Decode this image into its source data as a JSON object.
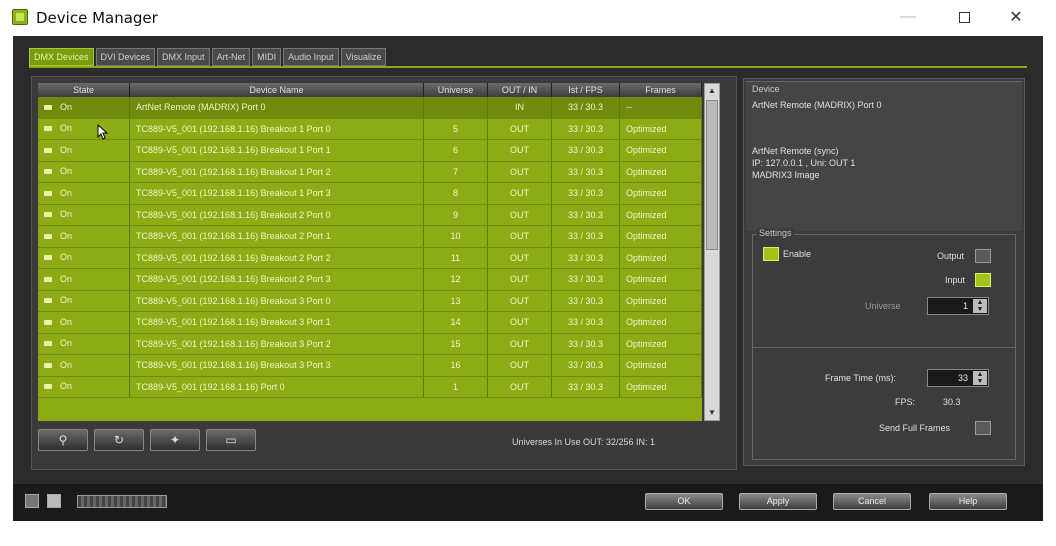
{
  "window": {
    "title": "Device Manager"
  },
  "tabs": [
    "DMX Devices",
    "DVI Devices",
    "DMX Input",
    "Art-Net",
    "MIDI",
    "Audio Input",
    "Visualize"
  ],
  "table": {
    "headers": [
      "State",
      "Device Name",
      "Universe",
      "OUT / IN",
      "Ist / FPS",
      "Frames"
    ],
    "rows": [
      {
        "state": "On",
        "name": "ArtNet Remote (MADRIX) Port 0",
        "universe": "",
        "outin": "IN",
        "fps": "33 / 30.3",
        "frames": "--"
      },
      {
        "state": "On",
        "name": "TC889-V5_001 (192.168.1.16) Breakout 1 Port 0",
        "universe": "5",
        "outin": "OUT",
        "fps": "33 / 30.3",
        "frames": "Optimized"
      },
      {
        "state": "On",
        "name": "TC889-V5_001 (192.168.1.16) Breakout 1 Port 1",
        "universe": "6",
        "outin": "OUT",
        "fps": "33 / 30.3",
        "frames": "Optimized"
      },
      {
        "state": "On",
        "name": "TC889-V5_001 (192.168.1.16) Breakout 1 Port 2",
        "universe": "7",
        "outin": "OUT",
        "fps": "33 / 30.3",
        "frames": "Optimized"
      },
      {
        "state": "On",
        "name": "TC889-V5_001 (192.168.1.16) Breakout 1 Port 3",
        "universe": "8",
        "outin": "OUT",
        "fps": "33 / 30.3",
        "frames": "Optimized"
      },
      {
        "state": "On",
        "name": "TC889-V5_001 (192.168.1.16) Breakout 2 Port 0",
        "universe": "9",
        "outin": "OUT",
        "fps": "33 / 30.3",
        "frames": "Optimized"
      },
      {
        "state": "On",
        "name": "TC889-V5_001 (192.168.1.16) Breakout 2 Port 1",
        "universe": "10",
        "outin": "OUT",
        "fps": "33 / 30.3",
        "frames": "Optimized"
      },
      {
        "state": "On",
        "name": "TC889-V5_001 (192.168.1.16) Breakout 2 Port 2",
        "universe": "11",
        "outin": "OUT",
        "fps": "33 / 30.3",
        "frames": "Optimized"
      },
      {
        "state": "On",
        "name": "TC889-V5_001 (192.168.1.16) Breakout 2 Port 3",
        "universe": "12",
        "outin": "OUT",
        "fps": "33 / 30.3",
        "frames": "Optimized"
      },
      {
        "state": "On",
        "name": "TC889-V5_001 (192.168.1.16) Breakout 3 Port 0",
        "universe": "13",
        "outin": "OUT",
        "fps": "33 / 30.3",
        "frames": "Optimized"
      },
      {
        "state": "On",
        "name": "TC889-V5_001 (192.168.1.16) Breakout 3 Port 1",
        "universe": "14",
        "outin": "OUT",
        "fps": "33 / 30.3",
        "frames": "Optimized"
      },
      {
        "state": "On",
        "name": "TC889-V5_001 (192.168.1.16) Breakout 3 Port 2",
        "universe": "15",
        "outin": "OUT",
        "fps": "33 / 30.3",
        "frames": "Optimized"
      },
      {
        "state": "On",
        "name": "TC889-V5_001 (192.168.1.16) Breakout 3 Port 3",
        "universe": "16",
        "outin": "OUT",
        "fps": "33 / 30.3",
        "frames": "Optimized"
      },
      {
        "state": "On",
        "name": "TC889-V5_001 (192.168.1.16) Port 0",
        "universe": "1",
        "outin": "OUT",
        "fps": "33 / 30.3",
        "frames": "Optimized"
      }
    ]
  },
  "universes_in_use": "Universes In Use OUT: 32/256  IN: 1",
  "device_panel": {
    "title": "Device",
    "line1": "ArtNet Remote (MADRIX) Port 0",
    "line2": "ArtNet Remote (sync)",
    "line3": "IP: 127.0.0.1 , Uni: OUT 1",
    "line4": "MADRIX3 Image"
  },
  "settings": {
    "title": "Settings",
    "enable_label": "Enable",
    "output_label": "Output",
    "input_label": "Input",
    "universe_label": "Universe",
    "universe_value": "1",
    "frame_time_label": "Frame Time (ms):",
    "frame_time_value": "33",
    "fps_label": "FPS:",
    "fps_value": "30.3",
    "send_full_frames_label": "Send Full Frames"
  },
  "buttons": {
    "ok": "OK",
    "apply": "Apply",
    "cancel": "Cancel",
    "help": "Help"
  },
  "colors": {
    "table_green": "#8cab14",
    "dialog_bg": "#2b2b2b",
    "accent": "#a3c31a"
  }
}
